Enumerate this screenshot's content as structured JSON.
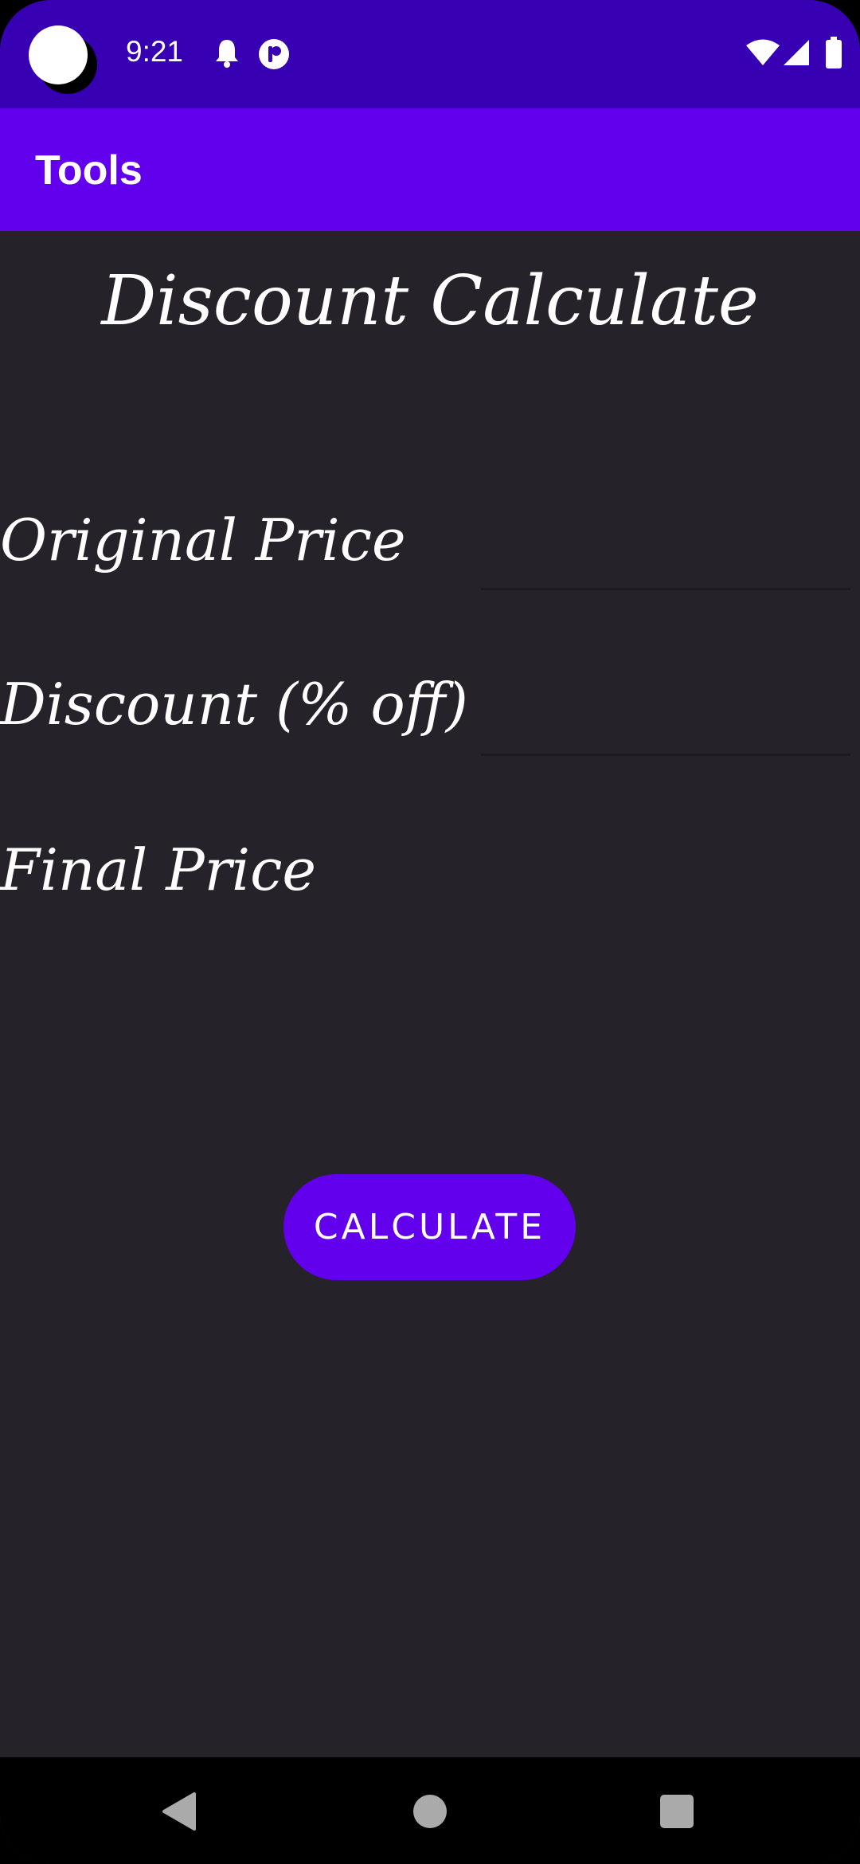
{
  "status_bar": {
    "time": "9:21",
    "icons": [
      "notification-bell-icon",
      "app-badge-icon",
      "wifi-icon",
      "cellular-signal-icon",
      "battery-icon"
    ]
  },
  "app_bar": {
    "title": "Tools"
  },
  "screen": {
    "title": "Discount Calculate",
    "fields": {
      "original_price": {
        "label": "Original Price",
        "value": ""
      },
      "discount": {
        "label": "Discount (% off)",
        "value": ""
      }
    },
    "final_price": {
      "label": "Final Price",
      "value": ""
    },
    "calculate_button": "CALCULATE"
  },
  "nav_bar": {
    "icons": [
      "back-icon",
      "home-icon",
      "recents-icon"
    ]
  },
  "colors": {
    "status_bar": "#3700b3",
    "app_bar": "#6200ee",
    "background": "#252329",
    "button": "#6200ee",
    "text": "#ffffff"
  }
}
